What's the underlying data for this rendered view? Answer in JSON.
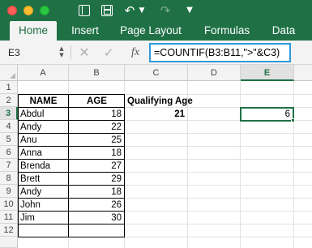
{
  "ribbon": {
    "tabs": [
      {
        "label": "Home",
        "active": true
      },
      {
        "label": "Insert",
        "active": false
      },
      {
        "label": "Page Layout",
        "active": false
      },
      {
        "label": "Formulas",
        "active": false
      },
      {
        "label": "Data",
        "active": false
      }
    ]
  },
  "colors": {
    "excel_green": "#1f7145",
    "formula_focus_blue": "#2f9ad8"
  },
  "toolbar_icons": [
    "sidebar-icon",
    "save-icon",
    "undo-icon",
    "redo-icon",
    "more-icon"
  ],
  "formula_bar": {
    "name_box": "E3",
    "fx_label": "fx",
    "formula": "=COUNTIF(B3:B11,\">\"&C3)"
  },
  "grid": {
    "columns": [
      "A",
      "B",
      "C",
      "D",
      "E"
    ],
    "rows": [
      "1",
      "2",
      "3",
      "4",
      "5",
      "6",
      "7",
      "8",
      "9",
      "10",
      "11",
      "12"
    ],
    "selected_column": "E",
    "selected_row": "3",
    "header": {
      "name": "NAME",
      "age": "AGE"
    },
    "qualifying_label": "Qualifying Age",
    "qualifying_value": "21",
    "result_value": "6",
    "people": [
      {
        "name": "Abdul",
        "age": "18"
      },
      {
        "name": "Andy",
        "age": "22"
      },
      {
        "name": "Anu",
        "age": "25"
      },
      {
        "name": "Anna",
        "age": "18"
      },
      {
        "name": "Brenda",
        "age": "27"
      },
      {
        "name": "Brett",
        "age": "29"
      },
      {
        "name": "Andy",
        "age": "18"
      },
      {
        "name": "John",
        "age": "26"
      },
      {
        "name": "Jim",
        "age": "30"
      }
    ]
  }
}
